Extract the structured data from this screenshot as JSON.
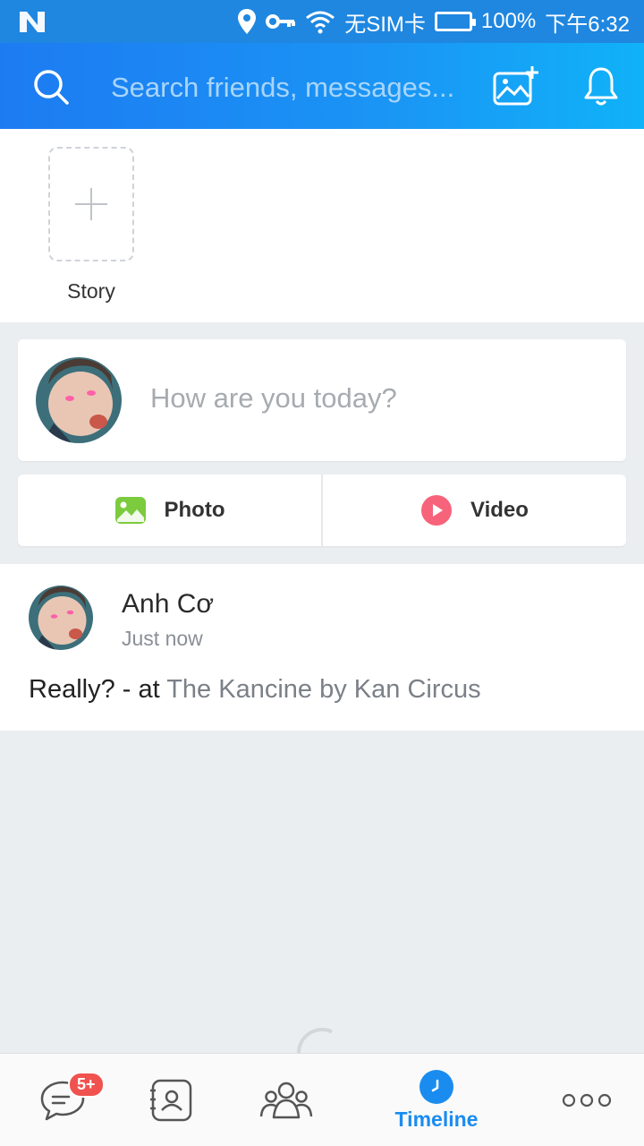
{
  "status_bar": {
    "carrier_text": "无SIM卡",
    "battery": "100%",
    "time": "下午6:32"
  },
  "header": {
    "search_placeholder": "Search friends, messages..."
  },
  "stories": {
    "add_label": "Story"
  },
  "composer": {
    "placeholder": "How are you today?",
    "photo_label": "Photo",
    "video_label": "Video"
  },
  "post": {
    "author": "Anh Cơ",
    "time": "Just now",
    "text": "Really? - at ",
    "place": "The Kancine by Kan Circus"
  },
  "bottom_nav": {
    "messages_badge": "5+",
    "timeline_label": "Timeline"
  },
  "colors": {
    "brand_blue": "#1a8cf0",
    "badge_red": "#f0524f",
    "photo_green": "#7ccb3e",
    "video_pink": "#f7637a"
  },
  "icons": [
    "search-icon",
    "add-photo-icon",
    "bell-icon",
    "plus-icon",
    "photo-icon",
    "play-icon",
    "chat-icon",
    "contacts-icon",
    "groups-icon",
    "clock-icon",
    "more-icon"
  ]
}
